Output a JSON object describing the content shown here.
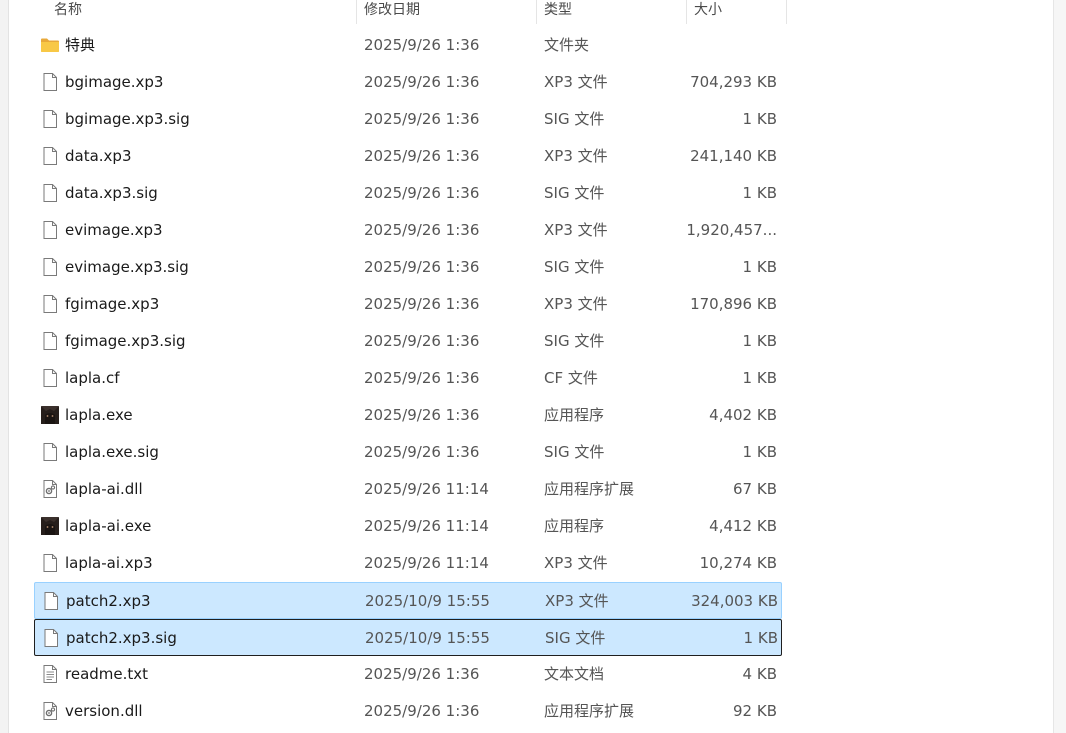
{
  "columns": {
    "name": "名称",
    "date": "修改日期",
    "type": "类型",
    "size": "大小"
  },
  "files": [
    {
      "name": "特典",
      "date": "2025/9/26 1:36",
      "type": "文件夹",
      "size": "",
      "icon": "folder-icon"
    },
    {
      "name": "bgimage.xp3",
      "date": "2025/9/26 1:36",
      "type": "XP3 文件",
      "size": "704,293 KB",
      "icon": "file-icon"
    },
    {
      "name": "bgimage.xp3.sig",
      "date": "2025/9/26 1:36",
      "type": "SIG 文件",
      "size": "1 KB",
      "icon": "file-icon"
    },
    {
      "name": "data.xp3",
      "date": "2025/9/26 1:36",
      "type": "XP3 文件",
      "size": "241,140 KB",
      "icon": "file-icon"
    },
    {
      "name": "data.xp3.sig",
      "date": "2025/9/26 1:36",
      "type": "SIG 文件",
      "size": "1 KB",
      "icon": "file-icon"
    },
    {
      "name": "evimage.xp3",
      "date": "2025/9/26 1:36",
      "type": "XP3 文件",
      "size": "1,920,457...",
      "icon": "file-icon"
    },
    {
      "name": "evimage.xp3.sig",
      "date": "2025/9/26 1:36",
      "type": "SIG 文件",
      "size": "1 KB",
      "icon": "file-icon"
    },
    {
      "name": "fgimage.xp3",
      "date": "2025/9/26 1:36",
      "type": "XP3 文件",
      "size": "170,896 KB",
      "icon": "file-icon"
    },
    {
      "name": "fgimage.xp3.sig",
      "date": "2025/9/26 1:36",
      "type": "SIG 文件",
      "size": "1 KB",
      "icon": "file-icon"
    },
    {
      "name": "lapla.cf",
      "date": "2025/9/26 1:36",
      "type": "CF 文件",
      "size": "1 KB",
      "icon": "file-icon"
    },
    {
      "name": "lapla.exe",
      "date": "2025/9/26 1:36",
      "type": "应用程序",
      "size": "4,402 KB",
      "icon": "app-icon"
    },
    {
      "name": "lapla.exe.sig",
      "date": "2025/9/26 1:36",
      "type": "SIG 文件",
      "size": "1 KB",
      "icon": "file-icon"
    },
    {
      "name": "lapla-ai.dll",
      "date": "2025/9/26 11:14",
      "type": "应用程序扩展",
      "size": "67 KB",
      "icon": "dll-icon"
    },
    {
      "name": "lapla-ai.exe",
      "date": "2025/9/26 11:14",
      "type": "应用程序",
      "size": "4,412 KB",
      "icon": "app-icon"
    },
    {
      "name": "lapla-ai.xp3",
      "date": "2025/9/26 11:14",
      "type": "XP3 文件",
      "size": "10,274 KB",
      "icon": "file-icon"
    },
    {
      "name": "patch2.xp3",
      "date": "2025/10/9 15:55",
      "type": "XP3 文件",
      "size": "324,003 KB",
      "icon": "file-icon",
      "selected": true
    },
    {
      "name": "patch2.xp3.sig",
      "date": "2025/10/9 15:55",
      "type": "SIG 文件",
      "size": "1 KB",
      "icon": "file-icon",
      "selected": true,
      "focused": true
    },
    {
      "name": "readme.txt",
      "date": "2025/9/26 1:36",
      "type": "文本文档",
      "size": "4 KB",
      "icon": "text-file-icon"
    },
    {
      "name": "version.dll",
      "date": "2025/9/26 1:36",
      "type": "应用程序扩展",
      "size": "92 KB",
      "icon": "dll-icon"
    }
  ],
  "colors": {
    "selection_bg": "#cce8ff",
    "selection_border": "#99d1ff",
    "focus_border": "#1f1f1f",
    "folder": "#f8c846"
  }
}
